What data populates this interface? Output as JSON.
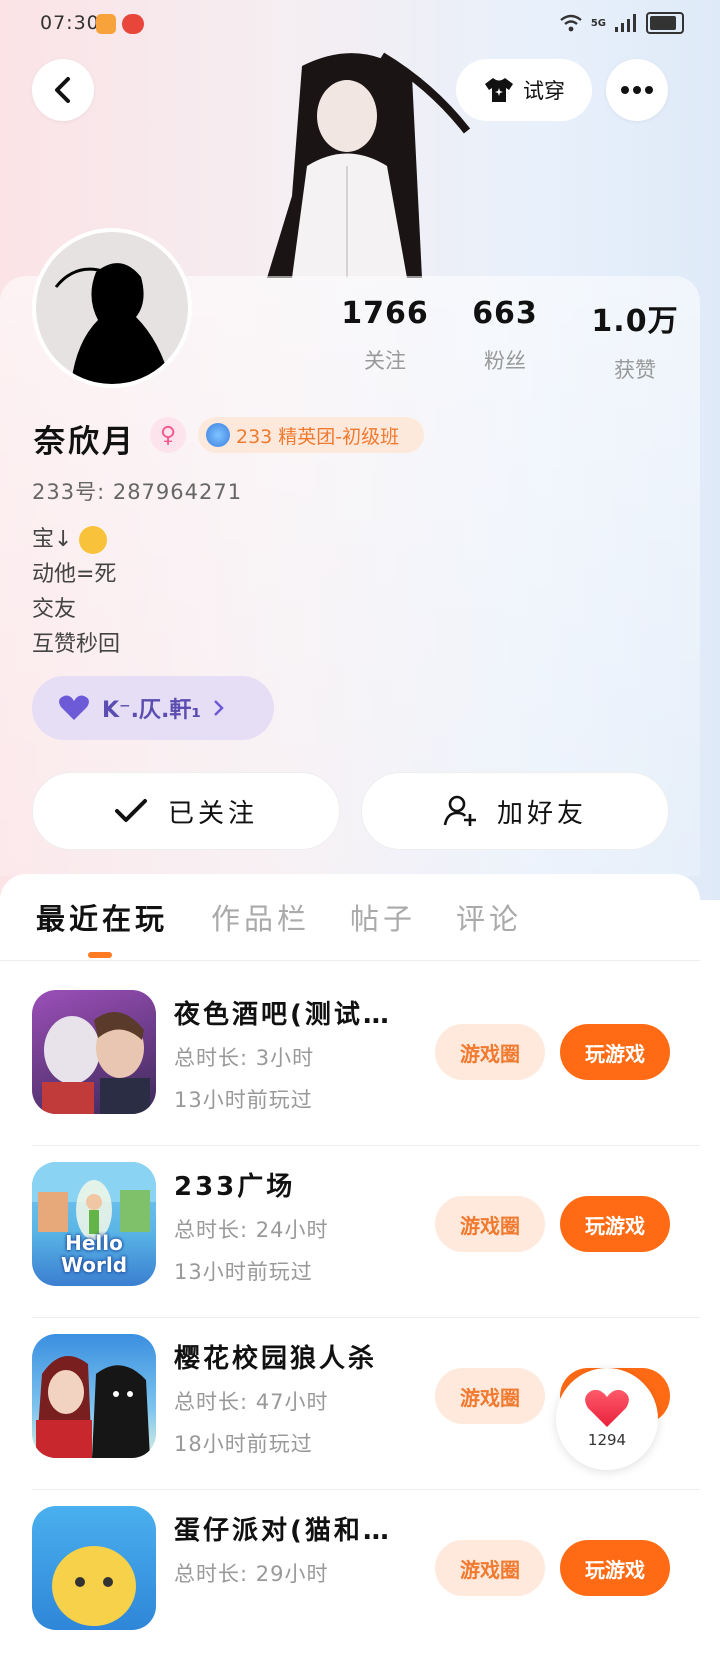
{
  "status_bar": {
    "time": "07:30",
    "network": "5G"
  },
  "header": {
    "try_on_label": "试穿"
  },
  "profile": {
    "name": "奈欣月",
    "gender_symbol": "♀",
    "badge": "233 精英团-初级班",
    "uid": "233号: 287964271",
    "bio": [
      "宝↓",
      "动他=死",
      "交友",
      "互赞秒回"
    ],
    "guild": "K⁻.仄.軒₁"
  },
  "stats": [
    {
      "value": "1766",
      "label": "关注"
    },
    {
      "value": "663",
      "label": "粉丝"
    },
    {
      "value": "1.0万",
      "label": "获赞"
    }
  ],
  "actions": {
    "follow_label": "已关注",
    "add_friend_label": "加好友"
  },
  "tabs": [
    "最近在玩",
    "作品栏",
    "帖子",
    "评论"
  ],
  "games": [
    {
      "title": "夜色酒吧(测试…",
      "time": "总时长: 3小时",
      "last": "13小时前玩过",
      "circle_label": "游戏圈",
      "play_label": "玩游戏"
    },
    {
      "title": "233广场",
      "time": "总时长: 24小时",
      "last": "13小时前玩过",
      "circle_label": "游戏圈",
      "play_label": "玩游戏"
    },
    {
      "title": "樱花校园狼人杀",
      "time": "总时长: 47小时",
      "last": "18小时前玩过",
      "circle_label": "游戏圈",
      "play_label": "玩游戏"
    },
    {
      "title": "蛋仔派对(猫和…",
      "time": "总时长: 29小时",
      "last": "",
      "circle_label": "游戏圈",
      "play_label": "玩游戏"
    }
  ],
  "game2_icon_text": "Hello World",
  "like_count": "1294",
  "colors": {
    "accent": "#ff6b14",
    "badge_text": "#f07a2f",
    "guild_bg": "#e6def5"
  }
}
